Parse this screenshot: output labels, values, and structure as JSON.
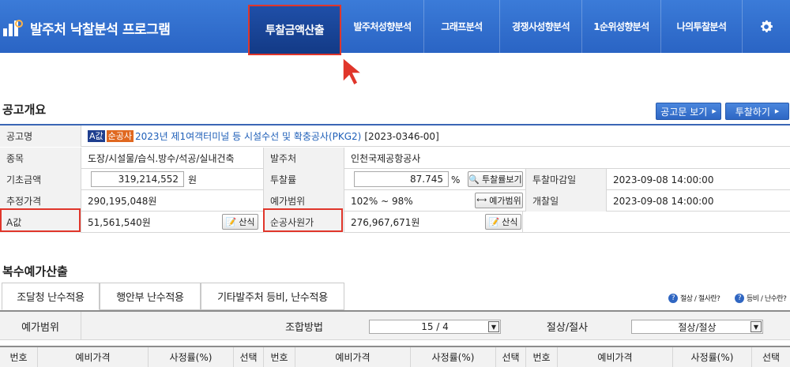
{
  "app": {
    "title": "발주처 낙찰분석 프로그램"
  },
  "nav": {
    "active": "투찰금액산출",
    "items": [
      "발주처성향분석",
      "그래프분석",
      "경쟁사성향분석",
      "1순위성향분석",
      "나의투찰분석"
    ]
  },
  "overview": {
    "title": "공고개요",
    "notice_button": "공고문 보기",
    "bid_button": "투찰하기",
    "labels": {
      "notice_name": "공고명",
      "category": "종목",
      "client": "발주처",
      "base_amount": "기초금액",
      "bid_rate": "투찰률",
      "bid_deadline": "투찰마감일",
      "estimated_price": "추정가격",
      "price_range": "예가범위",
      "opening_date": "개찰일",
      "a_value": "A값",
      "net_cost": "순공사원가"
    },
    "tags": {
      "a": "A값",
      "net": "순공사"
    },
    "notice_title": "2023년 제1여객터미널 등 시설수선 및 확충공사(PKG2)",
    "notice_no": "[2023-0346-00]",
    "category": "도장/시설물/습식.방수/석공/실내건축",
    "client": "인천국제공항공사",
    "base_amount": "319,214,552",
    "base_amount_unit": "원",
    "bid_rate": "87.745",
    "bid_rate_unit": "%",
    "bid_rate_button": "투찰률보기",
    "bid_deadline": "2023-09-08 14:00:00",
    "estimated_price": "290,195,048원",
    "price_range": "102% ~ 98%",
    "price_range_button": "예가범위",
    "opening_date": "2023-09-08 14:00:00",
    "a_value": "51,561,540원",
    "a_value_button": "산식",
    "net_cost": "276,967,671원",
    "net_cost_button": "산식"
  },
  "multi": {
    "title": "복수예가산출",
    "tabs": [
      "조달청 난수적용",
      "행안부 난수적용",
      "기타발주처 등비, 난수적용"
    ],
    "help": [
      "절상 / 절사란?",
      "등비 / 난수란?"
    ],
    "filter": {
      "range_label": "예가범위",
      "combo_label": "조합방법",
      "combo_value": "15 / 4",
      "round_label": "절상/절사",
      "round_value": "절상/절상"
    },
    "columns": [
      "번호",
      "예비가격",
      "사정률(%)",
      "선택",
      "번호",
      "예비가격",
      "사정률(%)",
      "선택",
      "번호",
      "예비가격",
      "사정률(%)",
      "선택"
    ]
  }
}
